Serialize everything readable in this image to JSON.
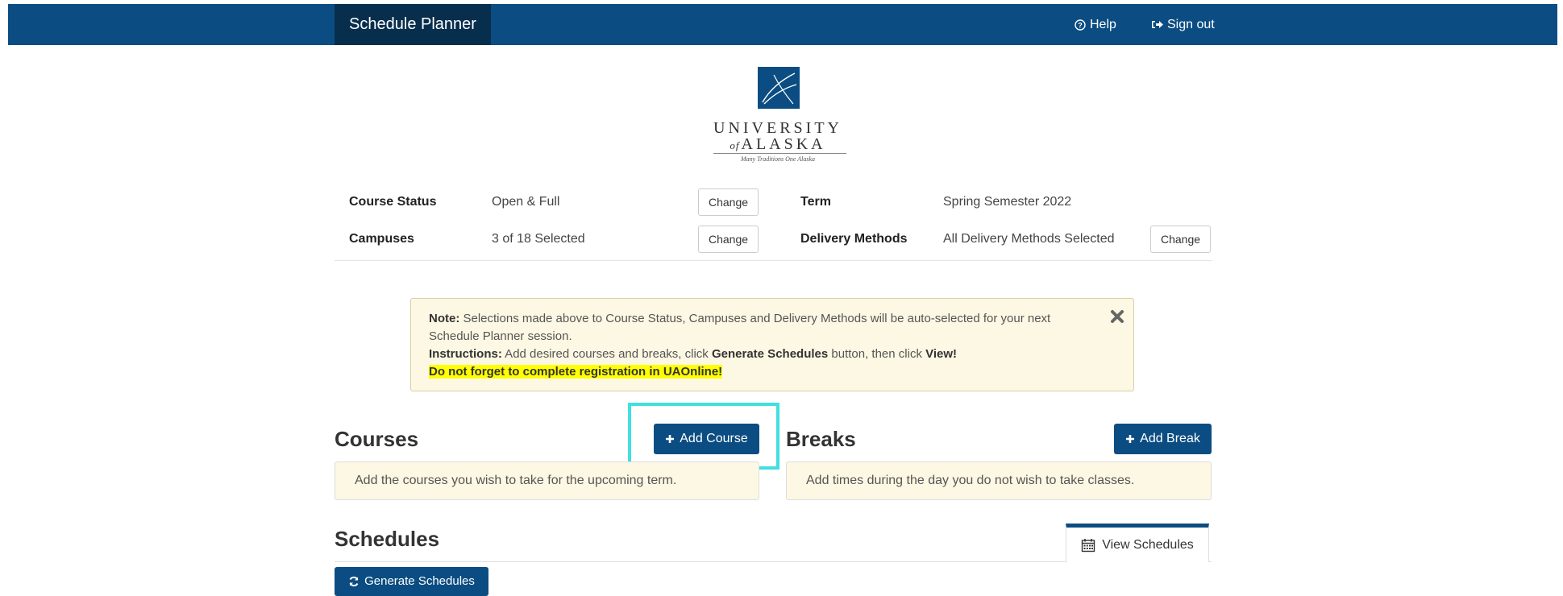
{
  "nav": {
    "brand": "Schedule Planner",
    "help": "Help",
    "signout": "Sign out"
  },
  "logo": {
    "line1": "UNIVERSITY",
    "of": "of",
    "line2": "ALASKA",
    "tagline": "Many Traditions One Alaska"
  },
  "settings": {
    "course_status_label": "Course Status",
    "course_status_value": "Open & Full",
    "campuses_label": "Campuses",
    "campuses_value": "3 of 18 Selected",
    "term_label": "Term",
    "term_value": "Spring Semester 2022",
    "delivery_label": "Delivery Methods",
    "delivery_value": "All Delivery Methods Selected",
    "change_label": "Change"
  },
  "note": {
    "note_label": "Note:",
    "note_text": " Selections made above to Course Status, Campuses and Delivery Methods will be auto-selected for your next Schedule Planner session.",
    "instr_label": "Instructions:",
    "instr_text1": " Add desired courses and breaks, click ",
    "instr_bold1": "Generate Schedules",
    "instr_text2": " button, then click ",
    "instr_bold2": "View!",
    "warning": "Do not forget to complete registration in UAOnline!"
  },
  "courses": {
    "title": "Courses",
    "add_label": "Add Course",
    "empty_text": "Add the courses you wish to take for the upcoming term."
  },
  "breaks": {
    "title": "Breaks",
    "add_label": "Add Break",
    "empty_text": "Add times during the day you do not wish to take classes."
  },
  "schedules": {
    "title": "Schedules",
    "view_label": "View Schedules",
    "generate_label": "Generate Schedules"
  },
  "colors": {
    "primary": "#0b4d82",
    "brand_dark": "#082e4e",
    "note_bg": "#fcf8e3",
    "highlight": "#40e0e0"
  }
}
